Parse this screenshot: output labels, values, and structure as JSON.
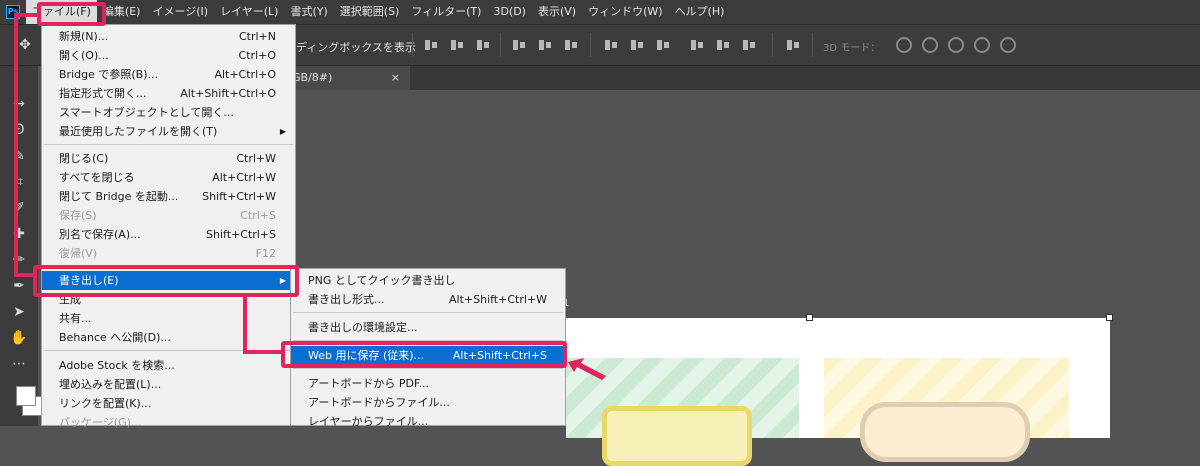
{
  "app": {
    "logo": "Ps"
  },
  "menubar": {
    "items": [
      "ファイル(F)",
      "編集(E)",
      "イメージ(I)",
      "レイヤー(L)",
      "書式(Y)",
      "選択範囲(S)",
      "フィルター(T)",
      "3D(D)",
      "表示(V)",
      "ウィンドウ(W)",
      "ヘルプ(H)"
    ],
    "active_index": 0
  },
  "options": {
    "bounding_label": "ディングボックスを表示",
    "mode3d_label": "3D モード："
  },
  "document_tab": {
    "label": "GB/8#)",
    "close": "×"
  },
  "ruler": {
    "mark": "1"
  },
  "file_menu": {
    "items": [
      {
        "label": "新規(N)...",
        "shortcut": "Ctrl+N"
      },
      {
        "label": "開く(O)...",
        "shortcut": "Ctrl+O"
      },
      {
        "label": "Bridge で参照(B)...",
        "shortcut": "Alt+Ctrl+O"
      },
      {
        "label": "指定形式で開く...",
        "shortcut": "Alt+Shift+Ctrl+O"
      },
      {
        "label": "スマートオブジェクトとして開く...",
        "shortcut": ""
      },
      {
        "label": "最近使用したファイルを開く(T)",
        "shortcut": "",
        "submenu": true
      },
      {
        "label": "閉じる(C)",
        "shortcut": "Ctrl+W"
      },
      {
        "label": "すべてを閉じる",
        "shortcut": "Alt+Ctrl+W"
      },
      {
        "label": "閉じて Bridge を起動...",
        "shortcut": "Shift+Ctrl+W"
      },
      {
        "label": "保存(S)",
        "shortcut": "Ctrl+S",
        "disabled": true
      },
      {
        "label": "別名で保存(A)...",
        "shortcut": "Shift+Ctrl+S"
      },
      {
        "label": "復帰(V)",
        "shortcut": "F12",
        "disabled": true
      },
      {
        "label": "書き出し(E)",
        "shortcut": "",
        "submenu": true,
        "highlighted": true
      },
      {
        "label": "生成",
        "shortcut": ""
      },
      {
        "label": "共有...",
        "shortcut": ""
      },
      {
        "label": "Behance へ公開(D)...",
        "shortcut": ""
      },
      {
        "label": "Adobe Stock を検索...",
        "shortcut": ""
      },
      {
        "label": "埋め込みを配置(L)...",
        "shortcut": ""
      },
      {
        "label": "リンクを配置(K)...",
        "shortcut": ""
      },
      {
        "label": "パッケージ(G)...",
        "shortcut": "",
        "disabled": true
      }
    ]
  },
  "export_submenu": {
    "items": [
      {
        "label": "PNG としてクイック書き出し",
        "shortcut": ""
      },
      {
        "label": "書き出し形式...",
        "shortcut": "Alt+Shift+Ctrl+W"
      },
      {
        "label": "書き出しの環境設定...",
        "shortcut": ""
      },
      {
        "label": "Web 用に保存 (従来)...",
        "shortcut": "Alt+Shift+Ctrl+S",
        "highlighted": true
      },
      {
        "label": "アートボードから PDF...",
        "shortcut": ""
      },
      {
        "label": "アートボードからファイル...",
        "shortcut": ""
      },
      {
        "label": "レイヤーからファイル...",
        "shortcut": ""
      }
    ]
  },
  "colors": {
    "highlight": "#e0245e",
    "menu_selection": "#0a6fd0",
    "menu_bg": "#f0f0f0",
    "ui_bg": "#535353"
  }
}
